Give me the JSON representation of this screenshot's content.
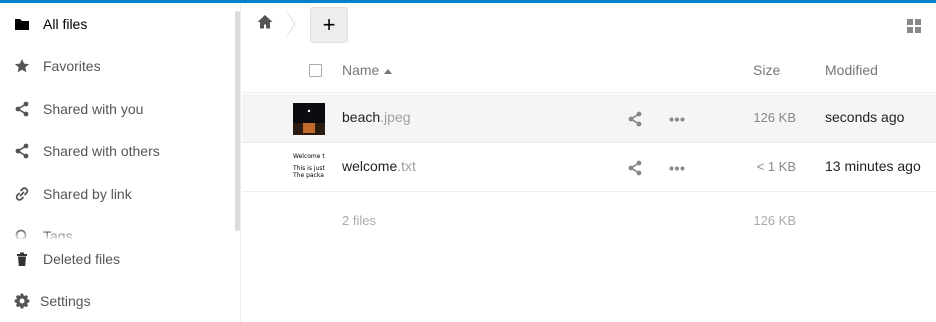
{
  "colors": {
    "accent": "#0082c9",
    "row_highlight": "#f5f5f5",
    "extension": "#a0a0a0"
  },
  "sidebar": {
    "items": [
      {
        "label": "All files",
        "icon": "folder-icon",
        "active": true
      },
      {
        "label": "Favorites",
        "icon": "star-icon"
      },
      {
        "label": "Shared with you",
        "icon": "share-icon"
      },
      {
        "label": "Shared with others",
        "icon": "share-icon"
      },
      {
        "label": "Shared by link",
        "icon": "link-icon"
      },
      {
        "label": "Tags",
        "icon": "tag-icon"
      }
    ],
    "bottom": [
      {
        "label": "Deleted files",
        "icon": "trash-icon"
      },
      {
        "label": "Settings",
        "icon": "gear-icon"
      }
    ]
  },
  "toolbar": {
    "add_label": "+"
  },
  "table": {
    "headers": {
      "name": "Name",
      "size": "Size",
      "modified": "Modified"
    },
    "rows": [
      {
        "name": "beach",
        "ext": ".jpeg",
        "size": "126 KB",
        "modified": "seconds ago",
        "thumb": "image"
      },
      {
        "name": "welcome",
        "ext": ".txt",
        "size": "< 1 KB",
        "modified": "13 minutes ago",
        "thumb": "text",
        "thumb_lines": [
          "Welcome t",
          "",
          "This is just",
          "The packa"
        ]
      }
    ],
    "summary": {
      "count": "2 files",
      "size": "126 KB"
    }
  }
}
